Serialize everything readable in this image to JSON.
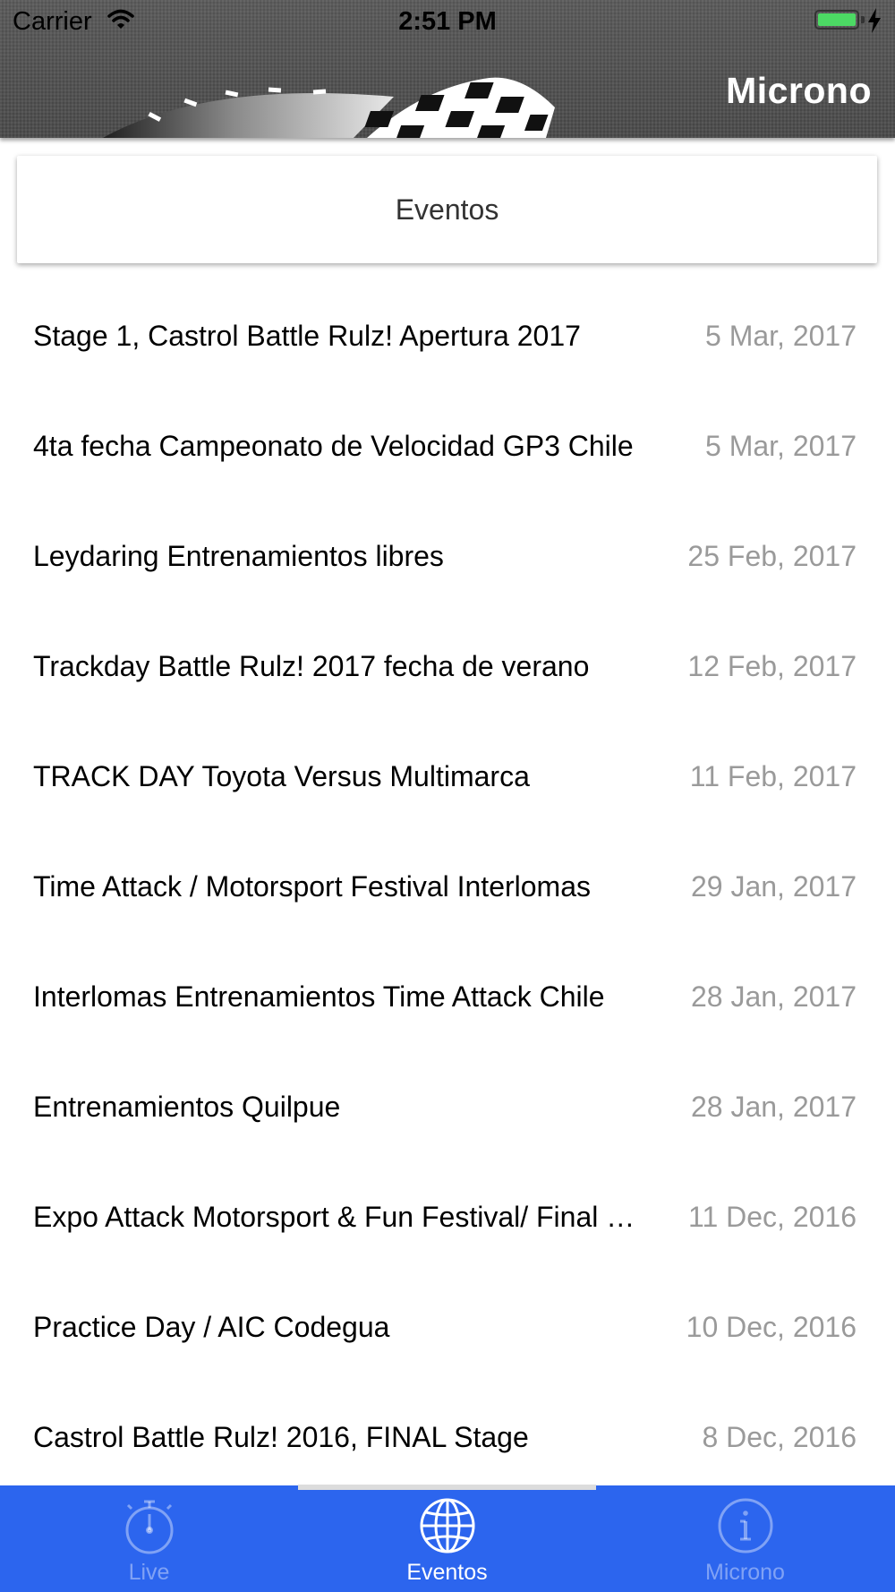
{
  "status_bar": {
    "carrier": "Carrier",
    "time": "2:51 PM"
  },
  "header": {
    "title": "Microno"
  },
  "segment": {
    "label": "Eventos"
  },
  "events": [
    {
      "name": "Stage 1, Castrol Battle Rulz! Apertura 2017",
      "date": "5 Mar, 2017"
    },
    {
      "name": "4ta fecha Campeonato de Velocidad GP3 Chile",
      "date": "5 Mar, 2017"
    },
    {
      "name": "Leydaring Entrenamientos libres",
      "date": "25 Feb, 2017"
    },
    {
      "name": "Trackday Battle Rulz! 2017 fecha de verano",
      "date": "12 Feb, 2017"
    },
    {
      "name": "TRACK DAY Toyota Versus Multimarca",
      "date": "11 Feb, 2017"
    },
    {
      "name": "Time Attack / Motorsport Festival Interlomas",
      "date": "29 Jan, 2017"
    },
    {
      "name": "Interlomas Entrenamientos Time Attack Chile",
      "date": "28 Jan, 2017"
    },
    {
      "name": "Entrenamientos Quilpue",
      "date": "28 Jan, 2017"
    },
    {
      "name": "Expo Attack Motorsport & Fun Festival/ Final …",
      "date": "11 Dec, 2016"
    },
    {
      "name": "Practice Day / AIC Codegua",
      "date": "10 Dec, 2016"
    },
    {
      "name": "Castrol Battle Rulz! 2016, FINAL Stage",
      "date": "8 Dec, 2016"
    }
  ],
  "tabs": [
    {
      "label": "Live",
      "icon": "stopwatch-icon"
    },
    {
      "label": "Eventos",
      "icon": "globe-icon"
    },
    {
      "label": "Microno",
      "icon": "info-icon"
    }
  ],
  "colors": {
    "tabbar": "#2c65ee",
    "header": "#4f4f4f",
    "date_text": "#9a9a9a",
    "battery": "#4cd964"
  }
}
